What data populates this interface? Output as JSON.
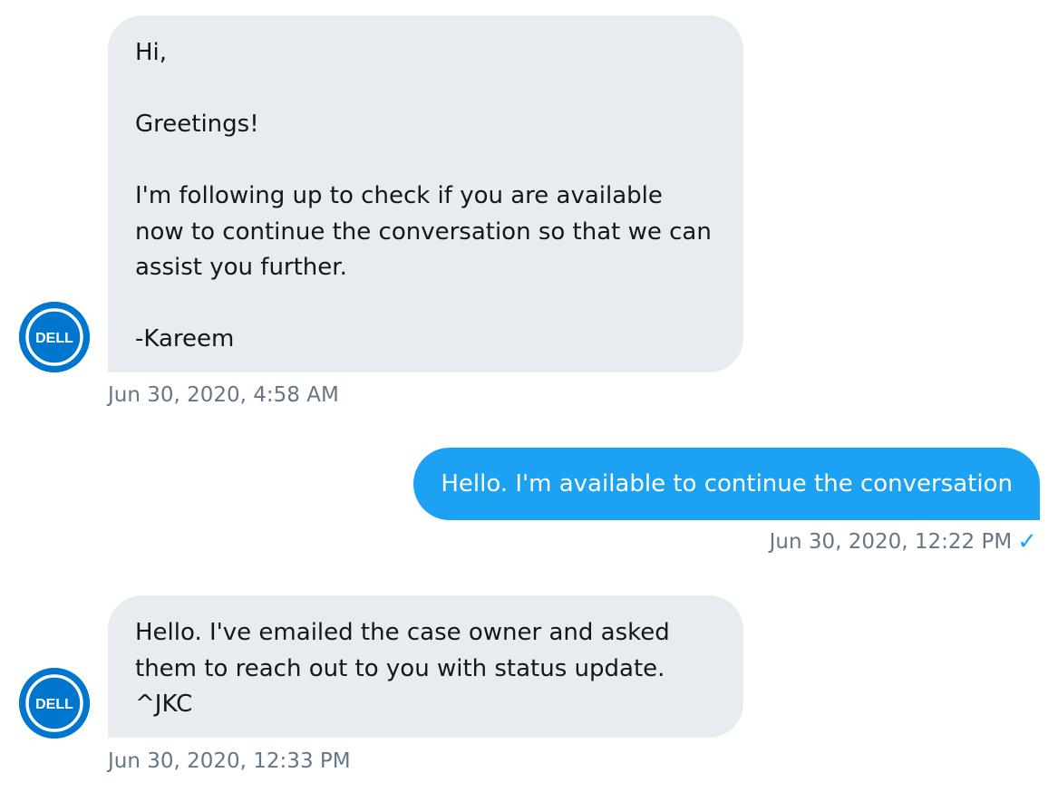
{
  "messages": [
    {
      "sender": "Dell",
      "avatar_icon": "dell-logo-icon",
      "text": "Hi,\n\nGreetings!\n\nI'm following up to check if you are available now to continue the conversation so that we can assist you further.\n\n-Kareem",
      "timestamp": "Jun 30, 2020, 4:58 AM"
    },
    {
      "sender": "me",
      "text": "Hello. I'm available to continue the conversation",
      "timestamp": "Jun 30, 2020, 12:22 PM",
      "status_icon": "checkmark-icon"
    },
    {
      "sender": "Dell",
      "avatar_icon": "dell-logo-icon",
      "text": "Hello. I've emailed the case owner and asked them to reach out to you with status update.\n^JKC",
      "timestamp": "Jun 30, 2020, 12:33 PM"
    }
  ],
  "avatar_label": "DELL",
  "colors": {
    "incoming_bubble": "#e6ecf0",
    "outgoing_bubble": "#1da1f2",
    "timestamp": "#657786",
    "dell_blue": "#0076ce",
    "check": "#1da1f2"
  }
}
